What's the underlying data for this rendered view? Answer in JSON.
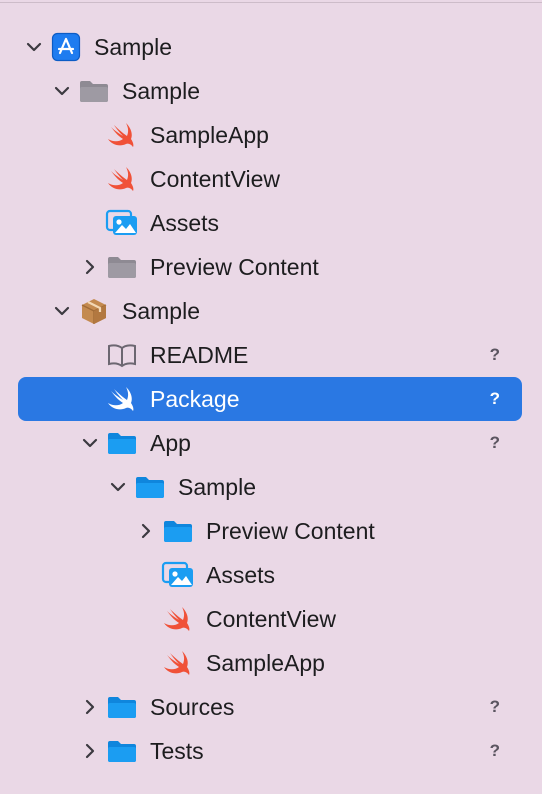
{
  "navigator": {
    "items": [
      {
        "label": "Sample",
        "icon": "app-store-project-icon",
        "disclosure": "expanded",
        "status": ""
      },
      {
        "label": "Sample",
        "icon": "gray-folder-icon",
        "disclosure": "expanded",
        "status": ""
      },
      {
        "label": "SampleApp",
        "icon": "swift-file-icon",
        "disclosure": "none",
        "status": ""
      },
      {
        "label": "ContentView",
        "icon": "swift-file-icon",
        "disclosure": "none",
        "status": ""
      },
      {
        "label": "Assets",
        "icon": "asset-catalog-icon",
        "disclosure": "none",
        "status": ""
      },
      {
        "label": "Preview Content",
        "icon": "gray-folder-icon",
        "disclosure": "collapsed",
        "status": ""
      },
      {
        "label": "Sample",
        "icon": "package-box-icon",
        "disclosure": "expanded",
        "status": ""
      },
      {
        "label": "README",
        "icon": "book-icon",
        "disclosure": "none",
        "status": "?"
      },
      {
        "label": "Package",
        "icon": "swift-file-icon",
        "disclosure": "none",
        "status": "?",
        "selected": true
      },
      {
        "label": "App",
        "icon": "blue-folder-icon",
        "disclosure": "expanded",
        "status": "?"
      },
      {
        "label": "Sample",
        "icon": "blue-folder-icon",
        "disclosure": "expanded",
        "status": ""
      },
      {
        "label": "Preview Content",
        "icon": "blue-folder-icon",
        "disclosure": "collapsed",
        "status": ""
      },
      {
        "label": "Assets",
        "icon": "asset-catalog-icon",
        "disclosure": "none",
        "status": ""
      },
      {
        "label": "ContentView",
        "icon": "swift-file-icon",
        "disclosure": "none",
        "status": ""
      },
      {
        "label": "SampleApp",
        "icon": "swift-file-icon",
        "disclosure": "none",
        "status": ""
      },
      {
        "label": "Sources",
        "icon": "blue-folder-icon",
        "disclosure": "collapsed",
        "status": "?"
      },
      {
        "label": "Tests",
        "icon": "blue-folder-icon",
        "disclosure": "collapsed",
        "status": "?"
      }
    ]
  },
  "colors": {
    "background": "#ead8e6",
    "selection": "#2a78e3",
    "swift": "#f05138",
    "blue_folder": "#1b9df2",
    "gray_folder": "#8e8a93",
    "package": "#c48a4f",
    "status_text": "#5b5560"
  }
}
